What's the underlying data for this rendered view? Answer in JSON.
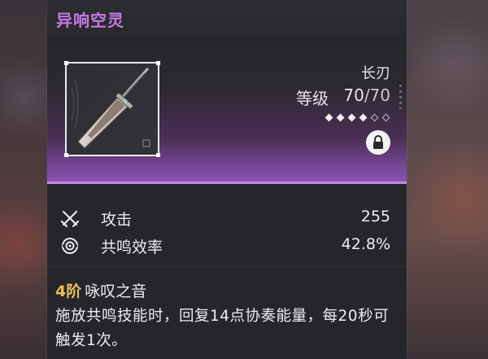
{
  "weapon": {
    "name": "异响空灵",
    "type": "长刃",
    "level_label": "等级",
    "level_current": "70",
    "level_max": "/70",
    "rank_filled": 4,
    "rank_total": 6,
    "colors": {
      "name": "#c77ae6",
      "accent": "#c987ee",
      "rank_label": "#e8c052"
    }
  },
  "stats": [
    {
      "icon": "crossed-swords-icon",
      "label": "攻击",
      "value": "255"
    },
    {
      "icon": "resonance-ring-icon",
      "label": "共鸣效率",
      "value": "42.8%"
    }
  ],
  "effect": {
    "rank": "4阶",
    "name": "咏叹之音",
    "description": "施放共鸣技能时，回复14点协奏能量，每20秒可触发1次。"
  }
}
